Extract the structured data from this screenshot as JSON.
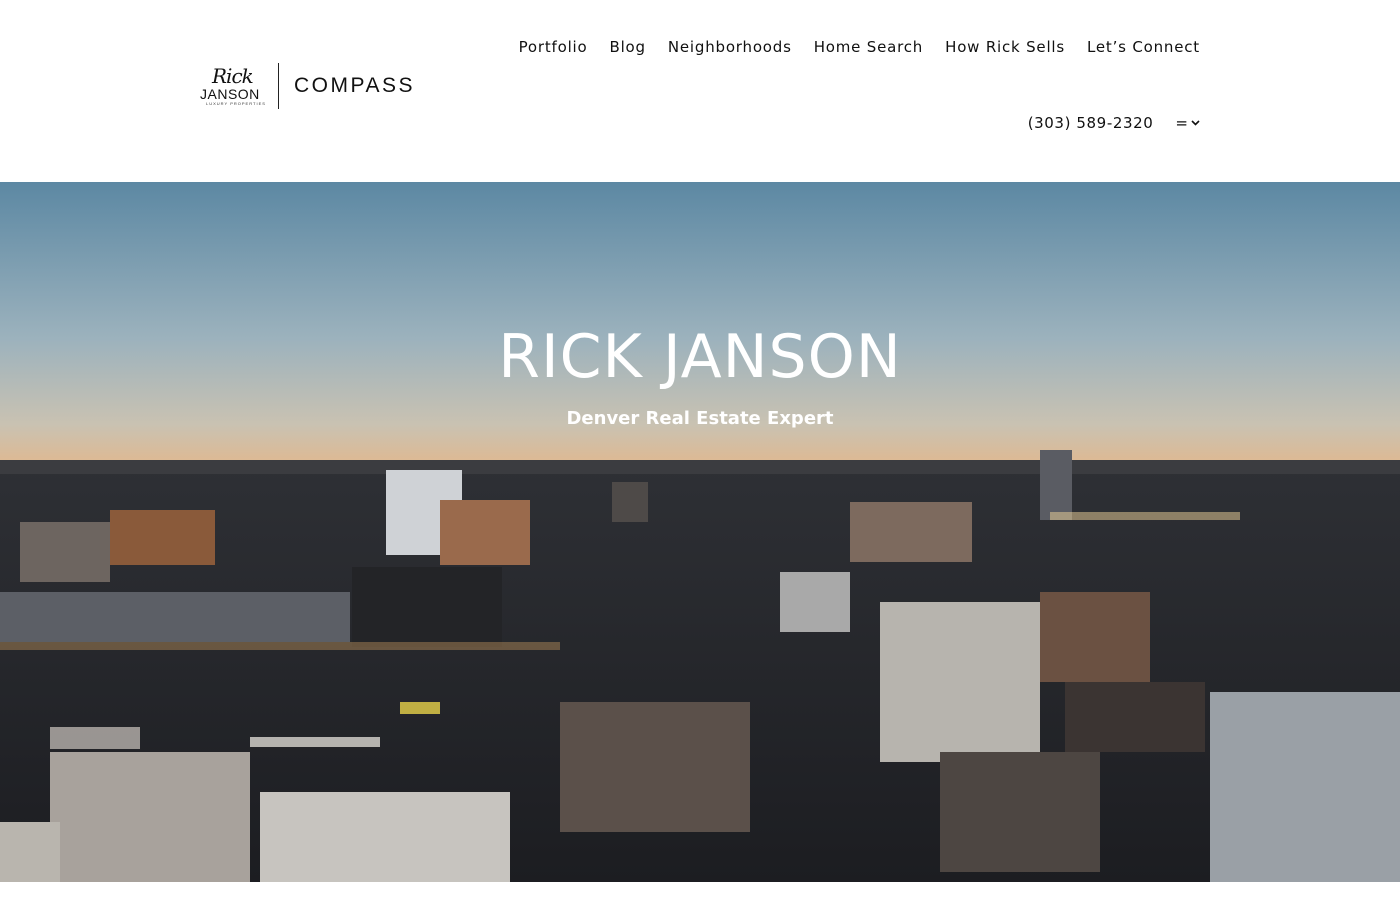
{
  "logo": {
    "script": "Rick",
    "name": "JANSON",
    "tagline": "LUXURY PROPERTIES",
    "brand": "COMPASS"
  },
  "nav": {
    "items": [
      {
        "label": "Portfolio"
      },
      {
        "label": "Blog"
      },
      {
        "label": "Neighborhoods"
      },
      {
        "label": "Home Search"
      },
      {
        "label": "How Rick Sells"
      },
      {
        "label": "Let’s Connect"
      }
    ]
  },
  "contact": {
    "phone": "(303) 589-2320",
    "menu_icon": "hamburger-icon",
    "chevron_icon": "chevron-down-icon"
  },
  "hero": {
    "title": "RICK JANSON",
    "subtitle": "Denver Real Estate Expert"
  },
  "colors": {
    "text": "#111111",
    "header_bg": "#ffffff",
    "hero_text": "#ffffff"
  }
}
